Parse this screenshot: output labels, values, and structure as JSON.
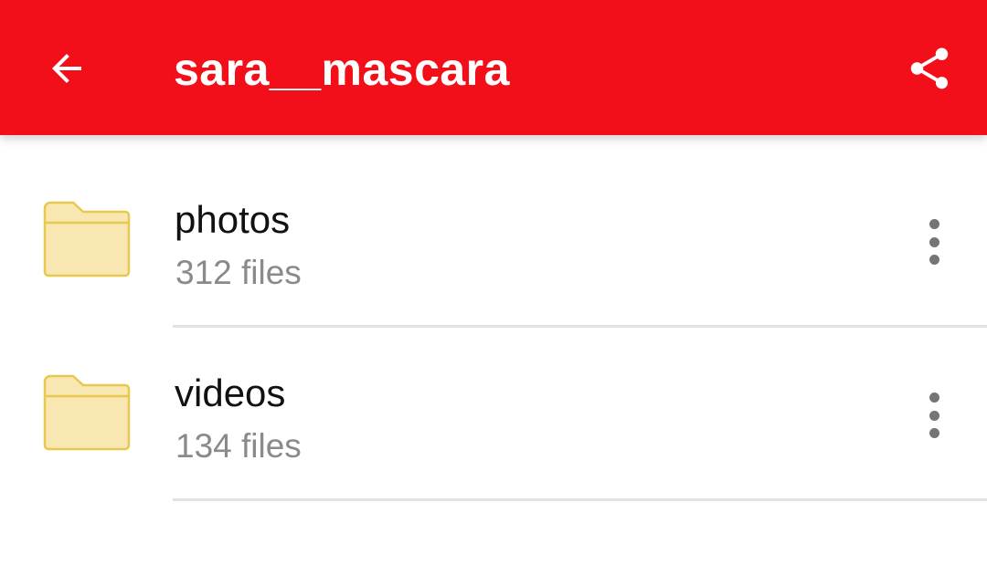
{
  "toolbar": {
    "title": "sara__mascara",
    "back_icon": "arrow-back-icon",
    "share_icon": "share-icon",
    "color": "#F20F19"
  },
  "folders": [
    {
      "name": "photos",
      "count": "312 files",
      "icon": "folder-icon",
      "menu_icon": "more-vert-icon"
    },
    {
      "name": "videos",
      "count": "134 files",
      "icon": "folder-icon",
      "menu_icon": "more-vert-icon"
    }
  ],
  "colors": {
    "folder_fill": "#F9E7B1",
    "folder_stroke": "#E8C84E",
    "secondary_text": "#8a8a8a"
  }
}
